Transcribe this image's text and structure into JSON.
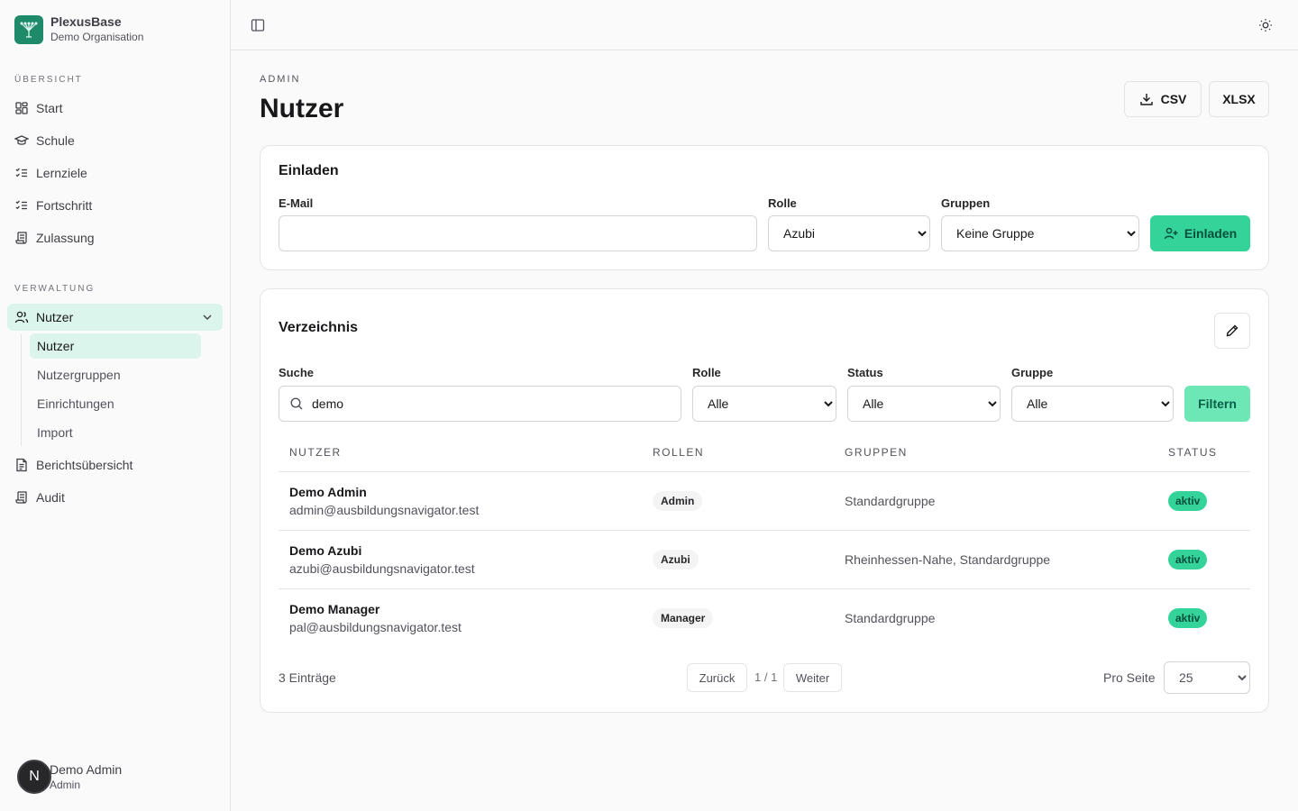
{
  "app": {
    "name": "PlexusBase",
    "organisation": "Demo Organisation"
  },
  "sidebar": {
    "section_overview": "ÜBERSICHT",
    "overview_items": [
      {
        "label": "Start",
        "icon": "dashboard-icon"
      },
      {
        "label": "Schule",
        "icon": "graduation-cap-icon"
      },
      {
        "label": "Lernziele",
        "icon": "checklist-icon"
      },
      {
        "label": "Fortschritt",
        "icon": "checklist-icon"
      },
      {
        "label": "Zulassung",
        "icon": "scroll-icon"
      }
    ],
    "section_admin": "VERWALTUNG",
    "users_group": {
      "label": "Nutzer",
      "icon": "users-icon",
      "expanded": true
    },
    "users_subitems": [
      "Nutzer",
      "Nutzergruppen",
      "Einrichtungen",
      "Import"
    ],
    "admin_items": [
      {
        "label": "Berichtsübersicht",
        "icon": "file-text-icon"
      },
      {
        "label": "Audit",
        "icon": "scroll-icon"
      }
    ],
    "user": {
      "initial": "N",
      "name": "Demo Admin",
      "role": "Admin"
    }
  },
  "header": {
    "eyebrow": "ADMIN",
    "title": "Nutzer",
    "export_csv": "CSV",
    "export_xlsx": "XLSX"
  },
  "invite": {
    "title": "Einladen",
    "email_label": "E-Mail",
    "email_value": "",
    "role_label": "Rolle",
    "role_value": "Azubi",
    "groups_label": "Gruppen",
    "groups_value": "Keine Gruppe",
    "submit": "Einladen"
  },
  "directory": {
    "title": "Verzeichnis",
    "search_label": "Suche",
    "search_value": "demo",
    "role_label": "Rolle",
    "role_value": "Alle",
    "status_label": "Status",
    "status_value": "Alle",
    "group_label": "Gruppe",
    "group_value": "Alle",
    "filter_button": "Filtern",
    "columns": [
      "NUTZER",
      "ROLLEN",
      "GRUPPEN",
      "STATUS"
    ],
    "rows": [
      {
        "name": "Demo Admin",
        "email": "admin@ausbildungsnavigator.test",
        "role": "Admin",
        "groups": "Standardgruppe",
        "status": "aktiv"
      },
      {
        "name": "Demo Azubi",
        "email": "azubi@ausbildungsnavigator.test",
        "role": "Azubi",
        "groups": "Rheinhessen-Nahe, Standardgruppe",
        "status": "aktiv"
      },
      {
        "name": "Demo Manager",
        "email": "pal@ausbildungsnavigator.test",
        "role": "Manager",
        "groups": "Standardgruppe",
        "status": "aktiv"
      }
    ],
    "count": "3 Einträge",
    "prev": "Zurück",
    "page": "1 / 1",
    "next": "Weiter",
    "per_page_label": "Pro Seite",
    "per_page_value": "25"
  },
  "colors": {
    "accent": "#34d399",
    "accent_soft": "#6ee7b7",
    "nav_active": "#dcf5ec",
    "brand": "#1f8a6a"
  }
}
